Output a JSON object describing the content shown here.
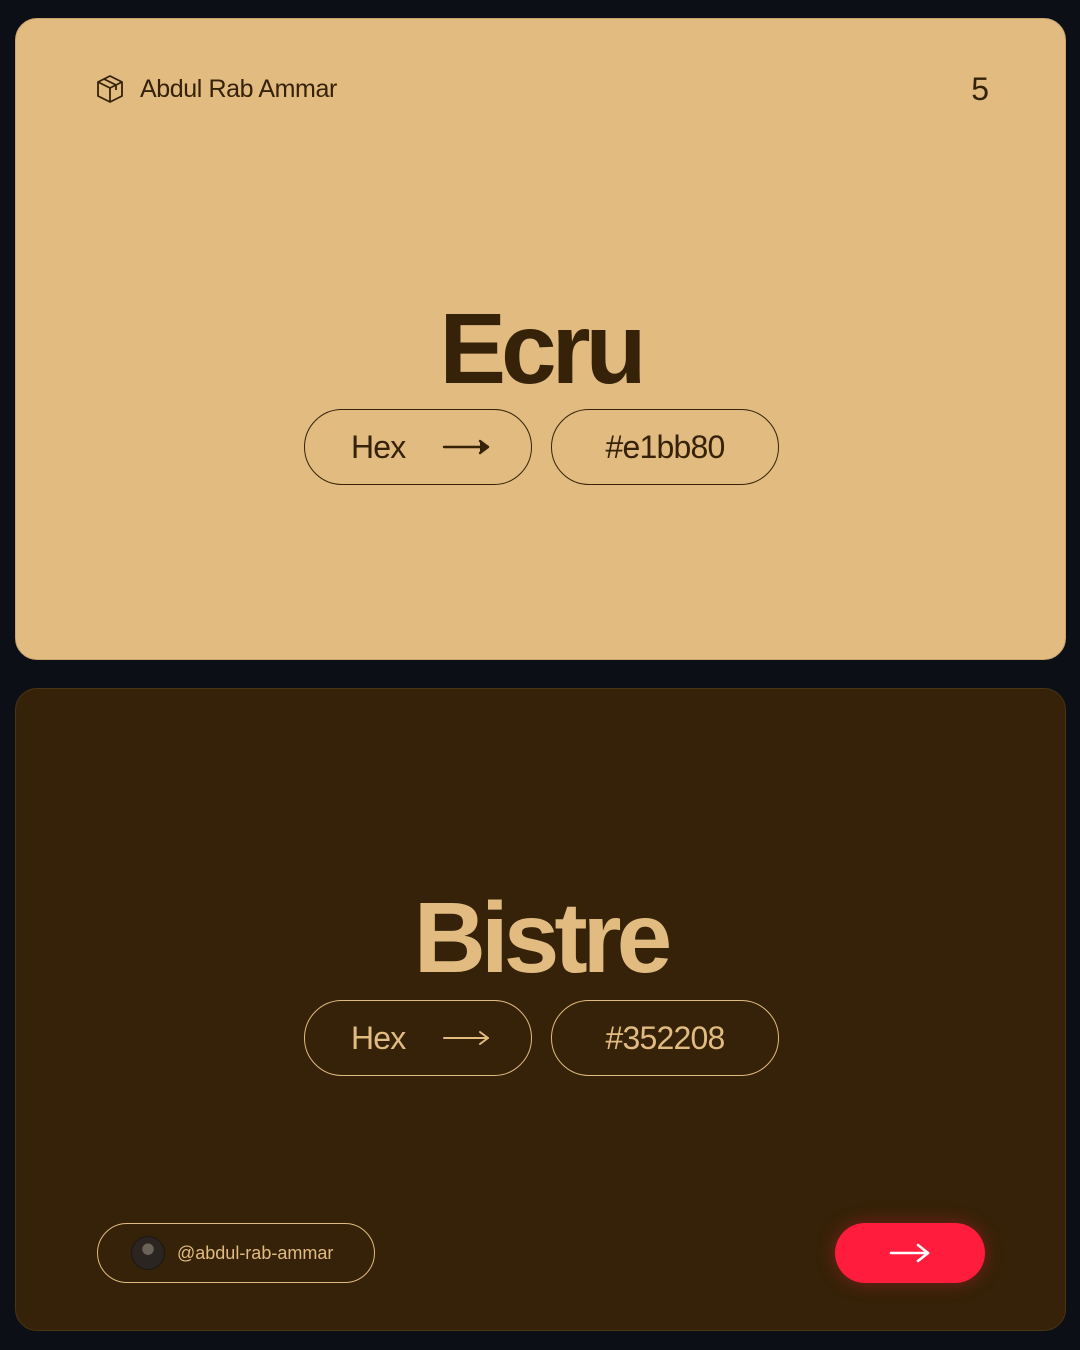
{
  "header": {
    "brand_icon": "cube-icon",
    "author": "Abdul Rab Ammar",
    "page_number": "5"
  },
  "colors": [
    {
      "name": "Ecru",
      "label": "Hex",
      "label_icon": "arrow-right-icon",
      "hex": "#e1bb80",
      "background": "#e1bb80",
      "text_color": "#352208"
    },
    {
      "name": "Bistre",
      "label": "Hex",
      "label_icon": "arrow-right-icon",
      "hex": "#352208",
      "background": "#352208",
      "text_color": "#e1bb80"
    }
  ],
  "footer": {
    "avatar_icon": "avatar",
    "handle": "@abdul-rab-ammar",
    "next_icon": "arrow-right-icon",
    "next_button_color": "#ff1c3c"
  }
}
